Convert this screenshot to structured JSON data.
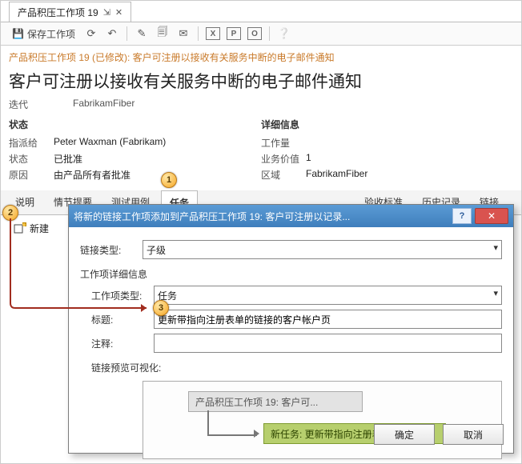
{
  "tab": {
    "title": "产品积压工作项 19"
  },
  "toolbar": {
    "save_label": "保存工作项"
  },
  "breadcrumb": "产品积压工作项 19 (已修改): 客户可注册以接收有关服务中断的电子邮件通知",
  "title": "客户可注册以接收有关服务中断的电子邮件通知",
  "iteration": {
    "label": "迭代",
    "value": "FabrikamFiber"
  },
  "left": {
    "header": "状态",
    "assigned_label": "指派给",
    "assigned_value": "Peter Waxman (Fabrikam)",
    "state_label": "状态",
    "state_value": "已批准",
    "reason_label": "原因",
    "reason_value": "由产品所有者批准"
  },
  "right": {
    "header": "详细信息",
    "effort_label": "工作量",
    "effort_value": "",
    "bizval_label": "业务价值",
    "bizval_value": "1",
    "area_label": "区域",
    "area_value": "FabrikamFiber"
  },
  "subtabs": {
    "desc": "说明",
    "story": "情节提要",
    "tests": "测试用例",
    "tasks": "任务",
    "accept": "验收标准",
    "history": "历史记录",
    "links": "链接..."
  },
  "new_button": "新建",
  "dialog": {
    "title": "将新的链接工作项添加到产品积压工作项 19: 客户可注册以记录...",
    "link_type_label": "链接类型:",
    "link_type_value": "子级",
    "details_header": "工作项详细信息",
    "witype_label": "工作项类型:",
    "witype_value": "任务",
    "title_label": "标题:",
    "title_value": "更新带指向注册表单的链接的客户帐户页",
    "comment_label": "注释:",
    "comment_value": "",
    "preview_label": "链接预览可视化:",
    "preview_parent": "产品积压工作项 19: 客户可...",
    "preview_child": "新任务: 更新带指向注册表...",
    "ok": "确定",
    "cancel": "取消"
  },
  "annotations": {
    "a1": "1",
    "a2": "2",
    "a3": "3"
  }
}
